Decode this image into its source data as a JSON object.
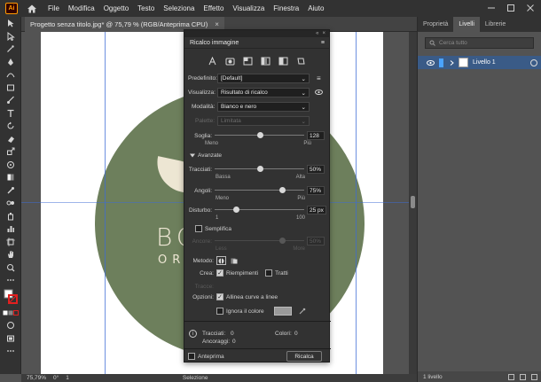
{
  "app": {
    "logo": "Ai"
  },
  "menu": [
    "File",
    "Modifica",
    "Oggetto",
    "Testo",
    "Seleziona",
    "Effetto",
    "Visualizza",
    "Finestra",
    "Aiuto"
  ],
  "document_tab": {
    "title": "Progetto senza titolo.jpg* @ 75,79 % (RGB/Anteprima CPU)",
    "close": "×"
  },
  "artwork": {
    "brand_line1": "BOT",
    "brand_line2": "ORGA",
    "circle_color": "#6d7f5c",
    "leaf_color": "#ede6d3"
  },
  "statusbar": {
    "zoom": "75,79%",
    "rotation": "0°",
    "artboard": "1",
    "mode": "Selezione"
  },
  "right_panel": {
    "tabs": [
      "Proprietà",
      "Livelli",
      "Librerie"
    ],
    "active_tab": "Livelli",
    "search_placeholder": "Cerca tutto",
    "layers": [
      {
        "name": "Livello 1"
      }
    ],
    "footer": "1 livello"
  },
  "trace_dialog": {
    "title": "Ricalco immagine",
    "preset_label": "Predefinito:",
    "preset_value": "[Default]",
    "view_label": "Visualizza:",
    "view_value": "Risultato di ricalco",
    "mode_label": "Modalità:",
    "mode_value": "Bianco e nero",
    "palette_label": "Palette:",
    "palette_value": "Limitata",
    "threshold": {
      "label": "Soglia:",
      "value": 128,
      "min_label": "Meno",
      "max_label": "Più",
      "fraction": 0.5
    },
    "advanced_label": "Avanzate",
    "paths": {
      "label": "Tracciati:",
      "value": "50%",
      "min_label": "Bassa",
      "max_label": "Alta",
      "fraction": 0.5
    },
    "corners": {
      "label": "Angoli:",
      "value": "75%",
      "min_label": "Meno",
      "max_label": "Più",
      "fraction": 0.75
    },
    "noise": {
      "label": "Disturbo:",
      "value": "25 px",
      "min_label": "1",
      "max_label": "100",
      "fraction": 0.24
    },
    "simplify_label": "Semplifica",
    "anchors": {
      "label": "Ancore:",
      "value": "50%",
      "min_label": "Less",
      "max_label": "More",
      "fraction": 0.75
    },
    "method_label": "Metodo:",
    "create_label": "Crea:",
    "fills_label": "Riempimenti",
    "strokes_label": "Tratti",
    "stroke_label": "Tracce:",
    "options_label": "Opzioni:",
    "snap_label": "Allinea curve a linee",
    "ignore_white_label": "Ignora il colore",
    "stats": {
      "paths_label": "Tracciati:",
      "paths_value": "0",
      "colors_label": "Colori:",
      "colors_value": "0",
      "anchors_label": "Ancoraggi:",
      "anchors_value": "0"
    },
    "preview_label": "Anteprima",
    "trace_button": "Ricalca"
  }
}
